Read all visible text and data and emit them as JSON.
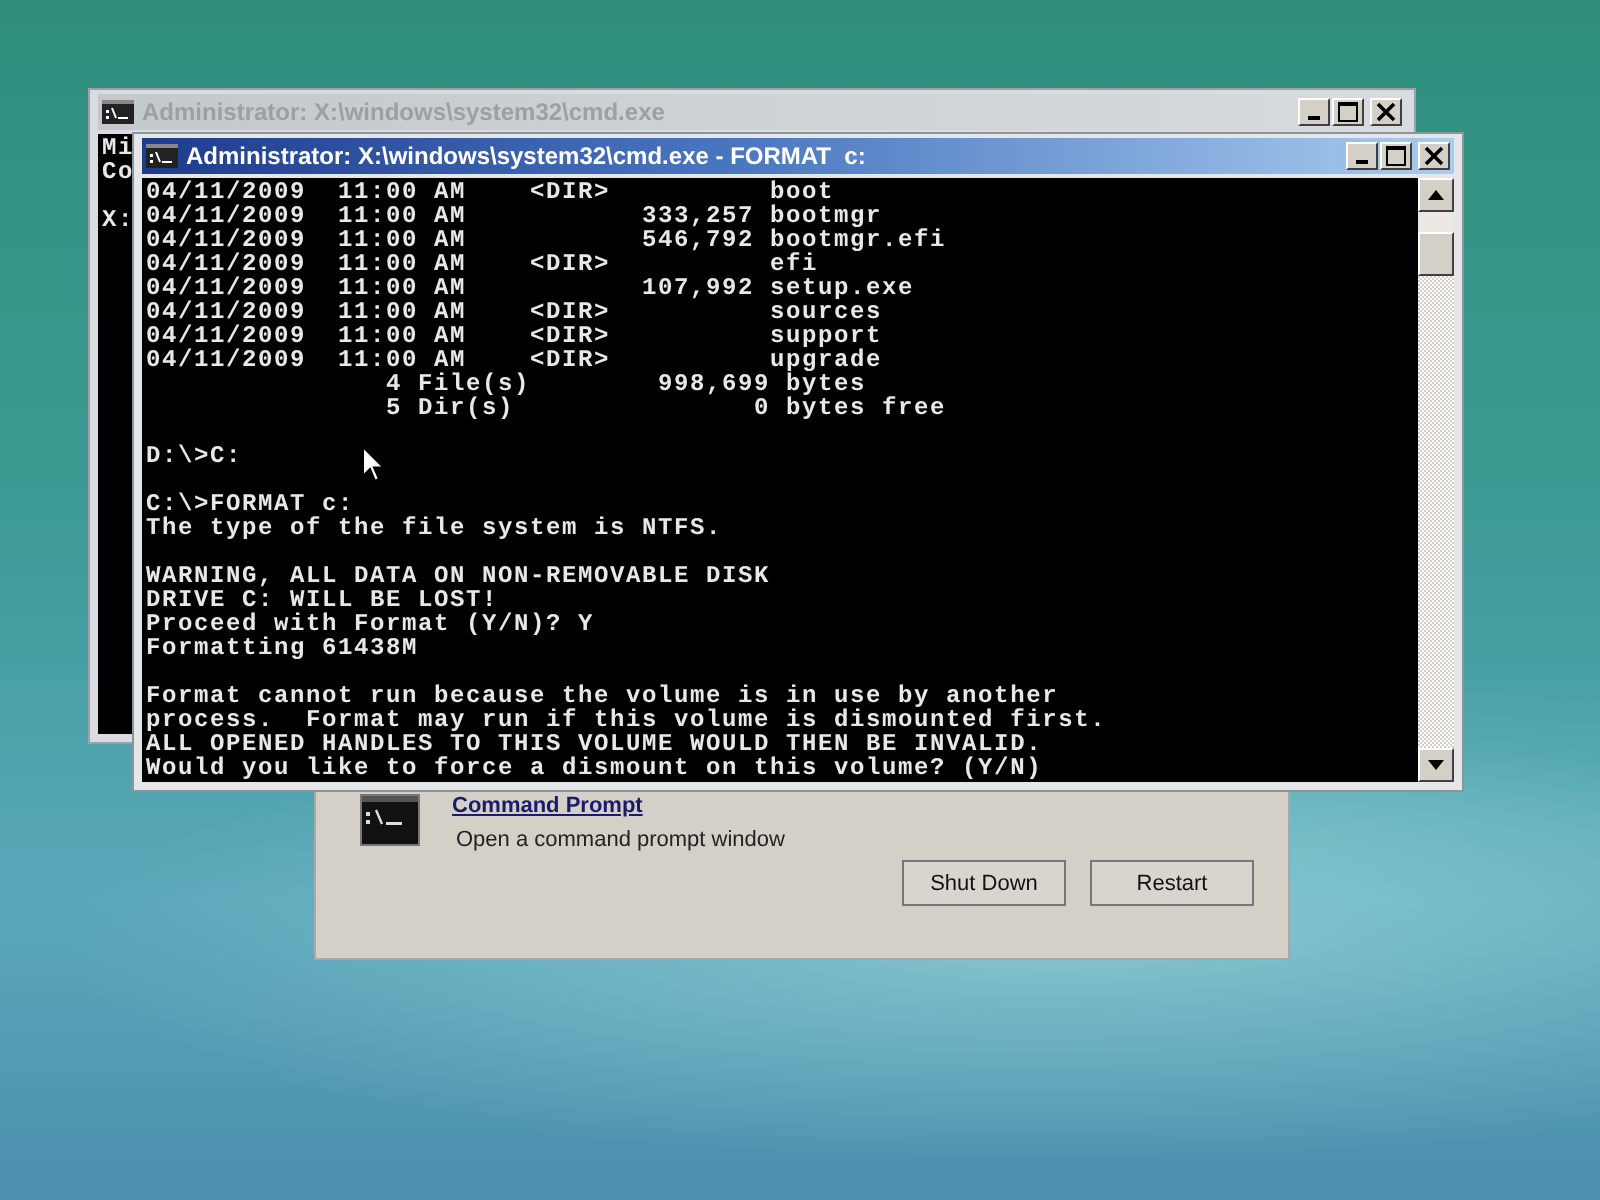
{
  "dialog": {
    "link": "Command Prompt",
    "description": "Open a command prompt window",
    "buttons": [
      "Shut Down",
      "Restart"
    ]
  },
  "windows": [
    {
      "title": "Administrator: X:\\windows\\system32\\cmd.exe",
      "active": false,
      "console_blocks": [
        [
          "Mi",
          "Co"
        ],
        [
          "X:"
        ]
      ]
    },
    {
      "title": "Administrator: X:\\windows\\system32\\cmd.exe - FORMAT  c:",
      "active": true,
      "console_blocks": [
        [
          "04/11/2009  11:00 AM    <DIR>          boot",
          "04/11/2009  11:00 AM           333,257 bootmgr",
          "04/11/2009  11:00 AM           546,792 bootmgr.efi",
          "04/11/2009  11:00 AM    <DIR>          efi",
          "04/11/2009  11:00 AM           107,992 setup.exe",
          "04/11/2009  11:00 AM    <DIR>          sources",
          "04/11/2009  11:00 AM    <DIR>          support",
          "04/11/2009  11:00 AM    <DIR>          upgrade",
          "               4 File(s)        998,699 bytes",
          "               5 Dir(s)               0 bytes free"
        ],
        [
          "D:\\>C:"
        ],
        [
          "C:\\>FORMAT c:",
          "The type of the file system is NTFS."
        ],
        [
          "WARNING, ALL DATA ON NON-REMOVABLE DISK",
          "DRIVE C: WILL BE LOST!",
          "Proceed with Format (Y/N)? Y",
          "Formatting 61438M"
        ],
        [
          "Format cannot run because the volume is in use by another",
          "process.  Format may run if this volume is dismounted first.",
          "ALL OPENED HANDLES TO THIS VOLUME WOULD THEN BE INVALID.",
          "Would you like to force a dismount on this volume? (Y/N)"
        ]
      ]
    }
  ]
}
